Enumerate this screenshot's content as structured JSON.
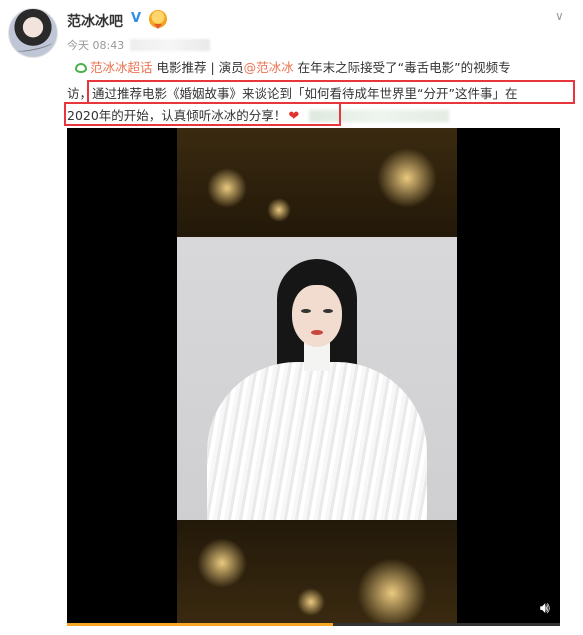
{
  "post": {
    "username": "范冰冰吧",
    "verified_badge": "V",
    "time": "今天 08:43",
    "icons": [
      "avatar",
      "verified-icon",
      "medal-icon",
      "chevron-down-icon",
      "topic-icon",
      "heart-icon",
      "volume-icon"
    ]
  },
  "content": {
    "topic_link": "范冰冰超话",
    "line1_rest": " 电影推荐 | 演员",
    "mention": "@范冰冰",
    "line1_tail": " 在年末之际接受了“毒舌电影”的视频专",
    "line2_start": "访，",
    "line2_boxed1": "通过推荐电影《婚姻故事》来谈论到「如何看待成年世界里“分开”这件事」在",
    "line3_boxed2": "2020年的开始，认真倾听冰冰的分享！"
  },
  "video": {
    "progress": 0.54,
    "colors": {
      "accent": "#f6a623",
      "highlight": "#e8363d",
      "link": "#eb7350"
    }
  }
}
